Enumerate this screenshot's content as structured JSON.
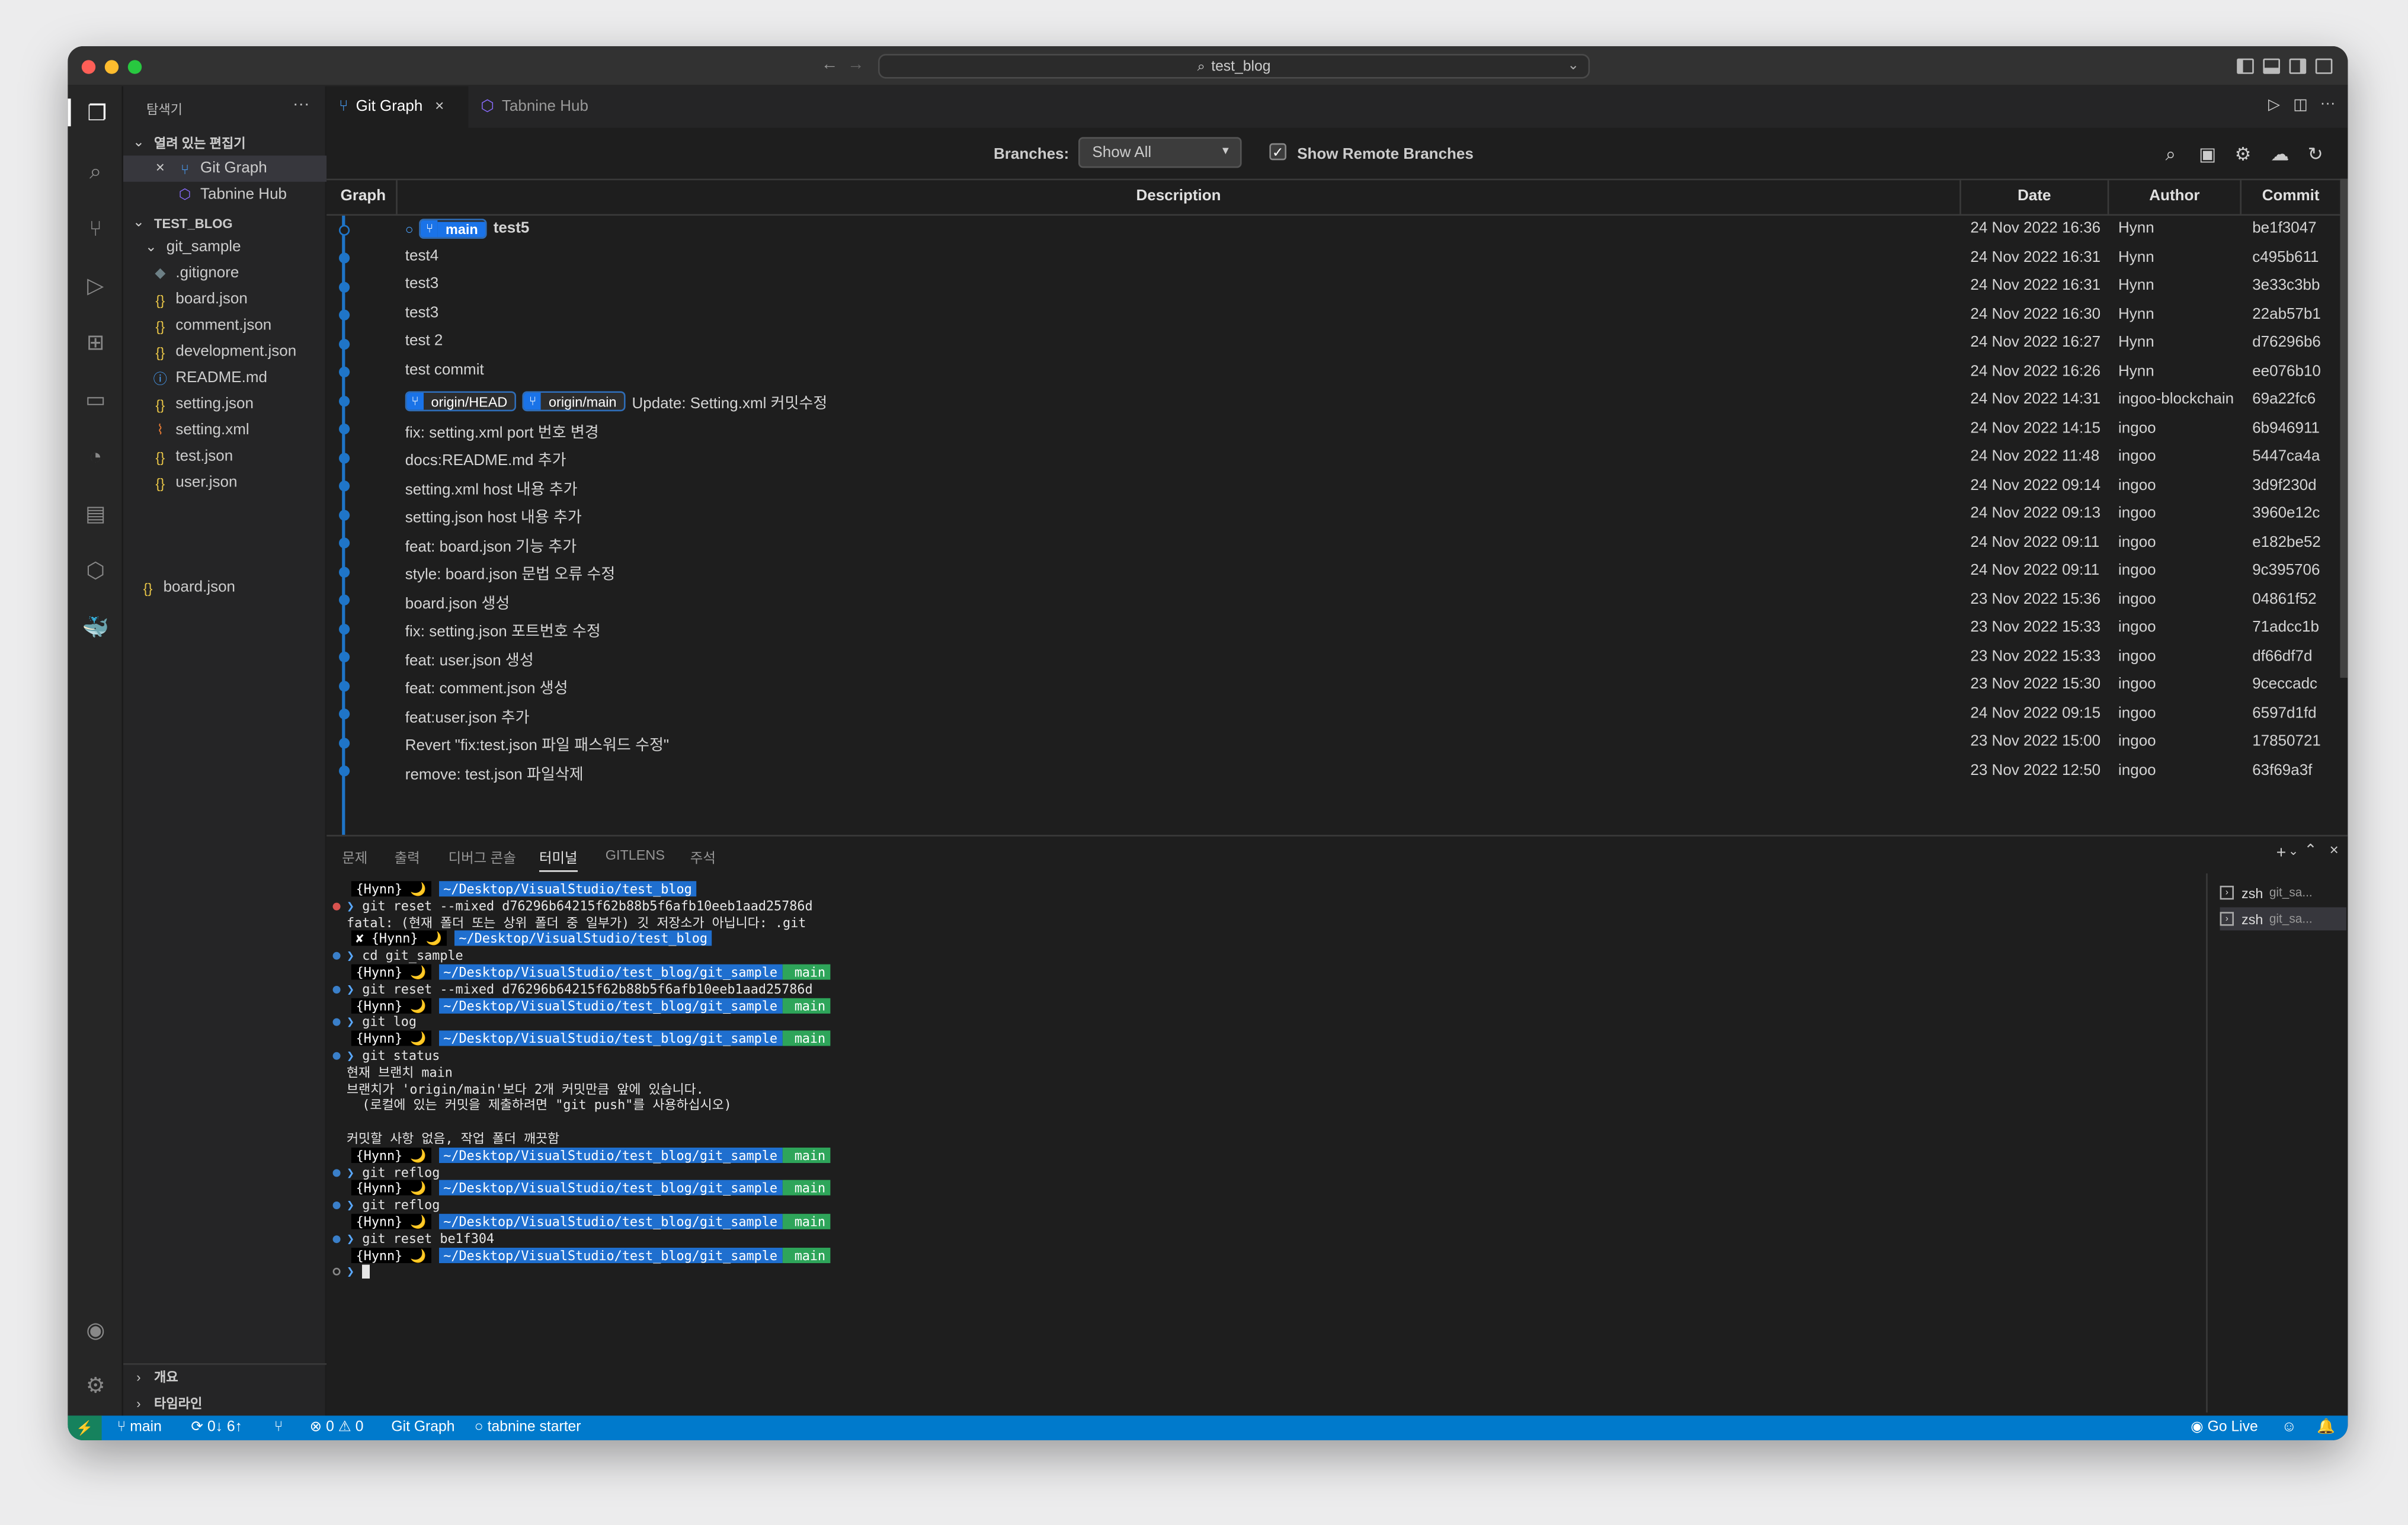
{
  "window": {
    "search": "test_blog"
  },
  "sidebar": {
    "title": "탐색기",
    "open_editors": {
      "header": "열려 있는 편집기",
      "items": [
        {
          "label": "Git Graph"
        },
        {
          "label": "Tabnine Hub"
        }
      ]
    },
    "project": {
      "header": "TEST_BLOG",
      "folder": "git_sample",
      "files": [
        ".gitignore",
        "board.json",
        "comment.json",
        "development.json",
        "README.md",
        "setting.json",
        "setting.xml",
        "test.json",
        "user.json"
      ],
      "root_file": "board.json"
    },
    "bottom_sections": [
      "개요",
      "타임라인"
    ]
  },
  "tabs": [
    {
      "label": "Git Graph",
      "active": true
    },
    {
      "label": "Tabnine Hub",
      "active": false
    }
  ],
  "git_graph": {
    "branches_label": "Branches:",
    "branches_value": "Show All",
    "remote_label": "Show Remote Branches",
    "remote_checked": true,
    "columns": [
      "Graph",
      "Description",
      "Date",
      "Author",
      "Commit"
    ],
    "commits": [
      {
        "desc": "test5",
        "date": "24 Nov 2022 16:36",
        "author": "Hynn",
        "commit": "be1f3047",
        "badges": [
          "main"
        ]
      },
      {
        "desc": "test4",
        "date": "24 Nov 2022 16:31",
        "author": "Hynn",
        "commit": "c495b611",
        "badges": []
      },
      {
        "desc": "test3",
        "date": "24 Nov 2022 16:31",
        "author": "Hynn",
        "commit": "3e33c3bb",
        "badges": []
      },
      {
        "desc": "test3",
        "date": "24 Nov 2022 16:30",
        "author": "Hynn",
        "commit": "22ab57b1",
        "badges": []
      },
      {
        "desc": "test 2",
        "date": "24 Nov 2022 16:27",
        "author": "Hynn",
        "commit": "d76296b6",
        "badges": []
      },
      {
        "desc": "test commit",
        "date": "24 Nov 2022 16:26",
        "author": "Hynn",
        "commit": "ee076b10",
        "badges": []
      },
      {
        "desc": "Update: Setting.xml 커밋수정",
        "date": "24 Nov 2022 14:31",
        "author": "ingoo-blockchain",
        "commit": "69a22fc6",
        "badges": [
          "origin/HEAD",
          "origin/main"
        ]
      },
      {
        "desc": "fix: setting.xml port 번호 변경",
        "date": "24 Nov 2022 14:15",
        "author": "ingoo",
        "commit": "6b946911",
        "badges": []
      },
      {
        "desc": "docs:README.md 추가",
        "date": "24 Nov 2022 11:48",
        "author": "ingoo",
        "commit": "5447ca4a",
        "badges": []
      },
      {
        "desc": "setting.xml host 내용 추가",
        "date": "24 Nov 2022 09:14",
        "author": "ingoo",
        "commit": "3d9f230d",
        "badges": []
      },
      {
        "desc": "setting.json host 내용 추가",
        "date": "24 Nov 2022 09:13",
        "author": "ingoo",
        "commit": "3960e12c",
        "badges": []
      },
      {
        "desc": "feat: board.json 기능 추가",
        "date": "24 Nov 2022 09:11",
        "author": "ingoo",
        "commit": "e182be52",
        "badges": []
      },
      {
        "desc": "style: board.json 문법 오류 수정",
        "date": "24 Nov 2022 09:11",
        "author": "ingoo",
        "commit": "9c395706",
        "badges": []
      },
      {
        "desc": "board.json 생성",
        "date": "23 Nov 2022 15:36",
        "author": "ingoo",
        "commit": "04861f52",
        "badges": []
      },
      {
        "desc": "fix: setting.json 포트번호 수정",
        "date": "23 Nov 2022 15:33",
        "author": "ingoo",
        "commit": "71adcc1b",
        "badges": []
      },
      {
        "desc": "feat: user.json 생성",
        "date": "23 Nov 2022 15:33",
        "author": "ingoo",
        "commit": "df66df7d",
        "badges": []
      },
      {
        "desc": "feat: comment.json 생성",
        "date": "23 Nov 2022 15:30",
        "author": "ingoo",
        "commit": "9ceccadc",
        "badges": []
      },
      {
        "desc": "feat:user.json 추가",
        "date": "24 Nov 2022 09:15",
        "author": "ingoo",
        "commit": "6597d1fd",
        "badges": []
      },
      {
        "desc": "Revert \"fix:test.json 파일 패스워드 수정\"",
        "date": "23 Nov 2022 15:00",
        "author": "ingoo",
        "commit": "17850721",
        "badges": []
      },
      {
        "desc": "remove: test.json 파일삭제",
        "date": "23 Nov 2022 12:50",
        "author": "ingoo",
        "commit": "63f69a3f",
        "badges": []
      }
    ]
  },
  "panel": {
    "tabs": [
      "문제",
      "출력",
      "디버그 콘솔",
      "터미널",
      "GITLENS",
      "주석"
    ],
    "active_tab": "터미널",
    "terminal_lines": [
      {
        "kind": "prompt",
        "user": "{Hynn} 🌙",
        "path": "~/Desktop/VisualStudio/test_blog",
        "branch": "",
        "mark": ""
      },
      {
        "kind": "cmd",
        "text": "git reset --mixed d76296b64215f62b88b5f6afb10eeb1aad25786d",
        "mark": "err"
      },
      {
        "kind": "out",
        "text": "fatal: (현재 폴더 또는 상위 폴더 중 일부가) 깃 저장소가 아닙니다: .git",
        "mark": ""
      },
      {
        "kind": "prompt",
        "user": "✘ {Hynn} 🌙",
        "path": "~/Desktop/VisualStudio/test_blog",
        "branch": "",
        "mark": ""
      },
      {
        "kind": "cmd",
        "text": "cd git_sample",
        "mark": "ok"
      },
      {
        "kind": "prompt",
        "user": "{Hynn} 🌙",
        "path": "~/Desktop/VisualStudio/test_blog/git_sample",
        "branch": " main",
        "mark": ""
      },
      {
        "kind": "cmd",
        "text": "git reset --mixed d76296b64215f62b88b5f6afb10eeb1aad25786d",
        "mark": "ok"
      },
      {
        "kind": "prompt",
        "user": "{Hynn} 🌙",
        "path": "~/Desktop/VisualStudio/test_blog/git_sample",
        "branch": " main",
        "mark": ""
      },
      {
        "kind": "cmd",
        "text": "git log",
        "mark": "ok"
      },
      {
        "kind": "prompt",
        "user": "{Hynn} 🌙",
        "path": "~/Desktop/VisualStudio/test_blog/git_sample",
        "branch": " main",
        "mark": ""
      },
      {
        "kind": "cmd",
        "text": "git status",
        "mark": "ok"
      },
      {
        "kind": "out",
        "text": "현재 브랜치 main",
        "mark": ""
      },
      {
        "kind": "out",
        "text": "브랜치가 'origin/main'보다 2개 커밋만큼 앞에 있습니다.",
        "mark": ""
      },
      {
        "kind": "out",
        "text": "  (로컬에 있는 커밋을 제출하려면 \"git push\"를 사용하십시오)",
        "mark": ""
      },
      {
        "kind": "out",
        "text": "",
        "mark": ""
      },
      {
        "kind": "out",
        "text": "커밋할 사항 없음, 작업 폴더 깨끗함",
        "mark": ""
      },
      {
        "kind": "prompt",
        "user": "{Hynn} 🌙",
        "path": "~/Desktop/VisualStudio/test_blog/git_sample",
        "branch": " main",
        "mark": ""
      },
      {
        "kind": "cmd",
        "text": "git reflog",
        "mark": "ok"
      },
      {
        "kind": "prompt",
        "user": "{Hynn} 🌙",
        "path": "~/Desktop/VisualStudio/test_blog/git_sample",
        "branch": " main",
        "mark": ""
      },
      {
        "kind": "cmd",
        "text": "git reflog",
        "mark": "ok"
      },
      {
        "kind": "prompt",
        "user": "{Hynn} 🌙",
        "path": "~/Desktop/VisualStudio/test_blog/git_sample",
        "branch": " main",
        "mark": ""
      },
      {
        "kind": "cmd",
        "text": "git reset be1f304",
        "mark": "ok"
      },
      {
        "kind": "prompt",
        "user": "{Hynn} 🌙",
        "path": "~/Desktop/VisualStudio/test_blog/git_sample",
        "branch": " main",
        "mark": ""
      },
      {
        "kind": "cursor",
        "text": "",
        "mark": "emp"
      }
    ],
    "terminals": [
      {
        "label": "zsh",
        "sub": "git_sa..."
      },
      {
        "label": "zsh",
        "sub": "git_sa..."
      }
    ]
  },
  "statusbar": {
    "branch": "main",
    "sync": "0↓ 6↑",
    "problems": "⊗ 0 ⚠ 0",
    "git_graph": "Git Graph",
    "tabnine": "tabnine starter",
    "go_live": "Go Live"
  },
  "colors": {
    "accent": "#007acc",
    "graph": "#1f75c8",
    "branch_badge": "#1a73e8"
  }
}
